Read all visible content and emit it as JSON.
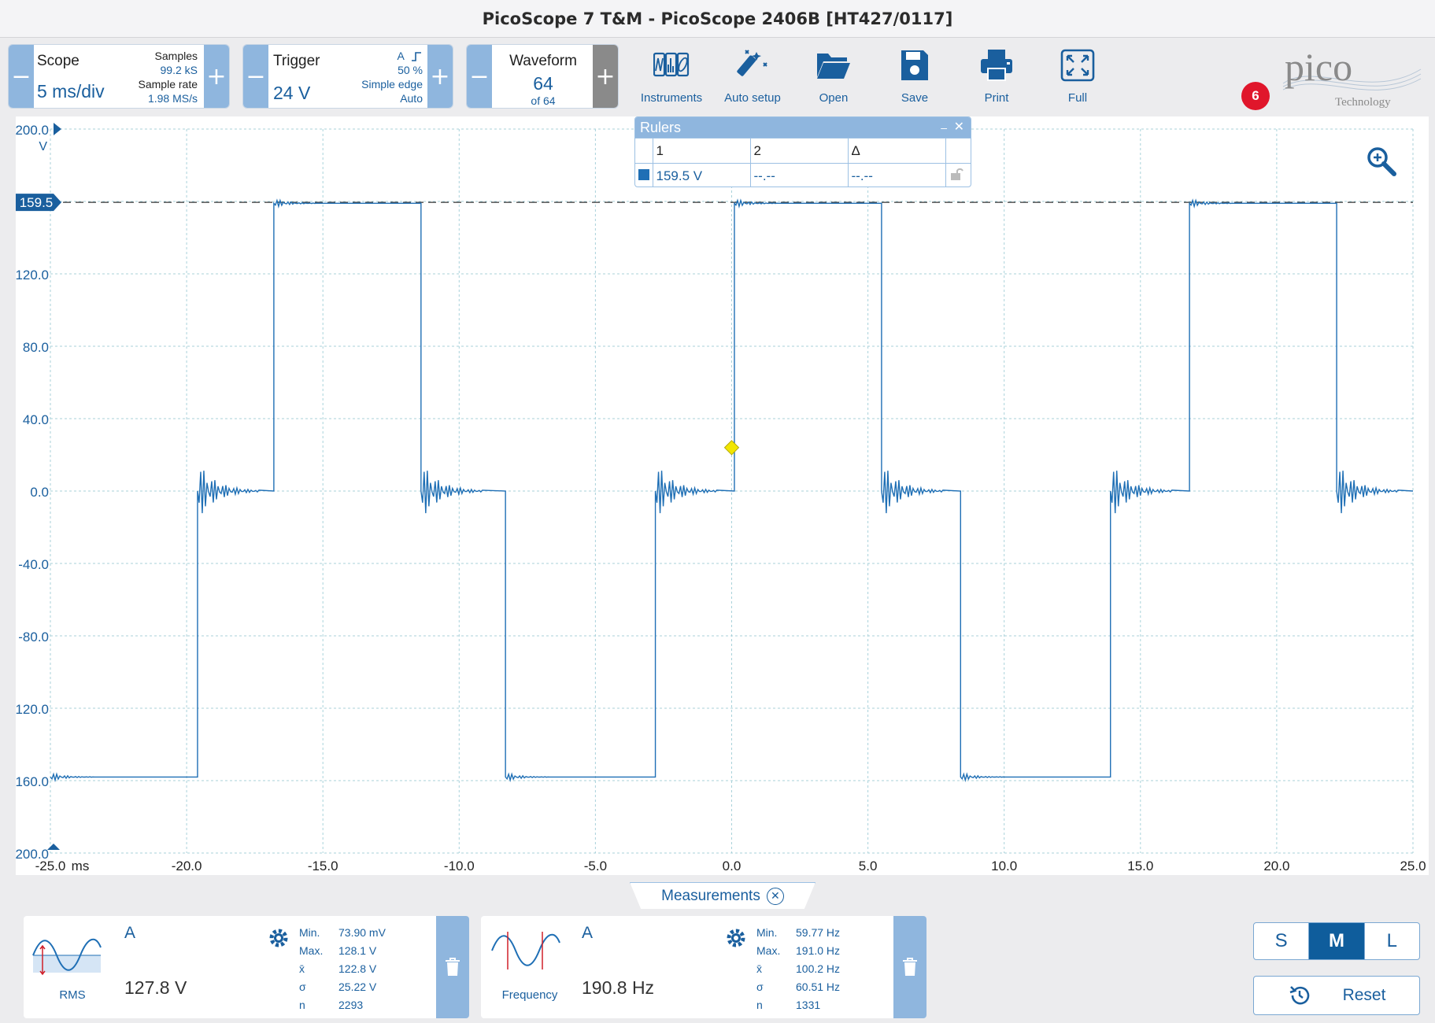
{
  "window": {
    "title": "PicoScope 7 T&M  - PicoScope 2406B [HT427/0117]"
  },
  "toolbar": {
    "scope": {
      "label": "Scope",
      "value": "5 ms/div",
      "samples_label": "Samples",
      "samples": "99.2 kS",
      "rate_label": "Sample rate",
      "rate": "1.98 MS/s"
    },
    "trigger": {
      "label": "Trigger",
      "value": "24 V",
      "channel": "A",
      "level": "50 %",
      "type": "Simple edge",
      "mode": "Auto"
    },
    "waveform": {
      "label": "Waveform",
      "value": "64",
      "of": "of 64"
    },
    "tools": [
      {
        "label": "Instruments",
        "icon": "instruments-icon"
      },
      {
        "label": "Auto setup",
        "icon": "wand-icon"
      },
      {
        "label": "Open",
        "icon": "folder-icon"
      },
      {
        "label": "Save",
        "icon": "floppy-icon"
      },
      {
        "label": "Print",
        "icon": "printer-icon"
      },
      {
        "label": "Full",
        "icon": "fullscreen-icon"
      }
    ],
    "notification_count": "6",
    "logo_text": "pico",
    "logo_subtext": "Technology"
  },
  "rulers": {
    "title": "Rulers",
    "headers": [
      "1",
      "2",
      "Δ"
    ],
    "row": {
      "v1": "159.5 V",
      "v2": "--.--",
      "delta": "--.--"
    }
  },
  "chart_data": {
    "type": "line",
    "xlabel": "ms",
    "ylabel": "V",
    "xlim": [
      -25,
      25
    ],
    "ylim": [
      -200,
      200
    ],
    "x_ticks": [
      "-25.0",
      "-20.0",
      "-15.0",
      "-10.0",
      "-5.0",
      "0.0",
      "5.0",
      "10.0",
      "15.0",
      "20.0",
      "25.0"
    ],
    "y_ticks": [
      "200.0",
      "159.5",
      "120.0",
      "80.0",
      "40.0",
      "0.0",
      "-40.0",
      "-80.0",
      "-120.0",
      "-160.0",
      "-200.0"
    ],
    "ruler_level": 159.5,
    "ruler_label": "159.5",
    "trigger_point": {
      "x": 0,
      "y": 24
    },
    "series": [
      {
        "color": "#1f6fb5",
        "segments": [
          {
            "x0": -25.0,
            "x1": -19.6,
            "y": -158
          },
          {
            "x0": -19.6,
            "x1": -16.8,
            "y": 0
          },
          {
            "x0": -16.8,
            "x1": -11.4,
            "y": 159
          },
          {
            "x0": -11.4,
            "x1": -8.3,
            "y": 0
          },
          {
            "x0": -8.3,
            "x1": -2.8,
            "y": -158
          },
          {
            "x0": -2.8,
            "x1": 0.1,
            "y": 0
          },
          {
            "x0": 0.1,
            "x1": 5.5,
            "y": 159
          },
          {
            "x0": 5.5,
            "x1": 8.4,
            "y": 0
          },
          {
            "x0": 8.4,
            "x1": 13.9,
            "y": -158
          },
          {
            "x0": 13.9,
            "x1": 16.8,
            "y": 0
          },
          {
            "x0": 16.8,
            "x1": 22.2,
            "y": 159
          },
          {
            "x0": 22.2,
            "x1": 25.0,
            "y": 0
          }
        ]
      }
    ]
  },
  "measurements": {
    "tab_label": "Measurements",
    "cards": [
      {
        "channel": "A",
        "type": "RMS",
        "value": "127.8 V",
        "stats": [
          {
            "k": "Min.",
            "v": "73.90 mV"
          },
          {
            "k": "Max.",
            "v": "128.1 V"
          },
          {
            "k": "x̄",
            "v": "122.8 V"
          },
          {
            "k": "σ",
            "v": "25.22 V"
          },
          {
            "k": "n",
            "v": "2293"
          }
        ]
      },
      {
        "channel": "A",
        "type": "Frequency",
        "value": "190.8 Hz",
        "stats": [
          {
            "k": "Min.",
            "v": "59.77 Hz"
          },
          {
            "k": "Max.",
            "v": "191.0 Hz"
          },
          {
            "k": "x̄",
            "v": "100.2 Hz"
          },
          {
            "k": "σ",
            "v": "60.51 Hz"
          },
          {
            "k": "n",
            "v": "1331"
          }
        ]
      }
    ]
  },
  "view": {
    "sizes": [
      "S",
      "M",
      "L"
    ],
    "active": "M",
    "reset_label": "Reset"
  },
  "colors": {
    "accent": "#1a5f9e",
    "panel": "#8fb6de",
    "trace": "#1f6fb5",
    "badge": "#e0162b",
    "trigger": "#f2e600"
  }
}
